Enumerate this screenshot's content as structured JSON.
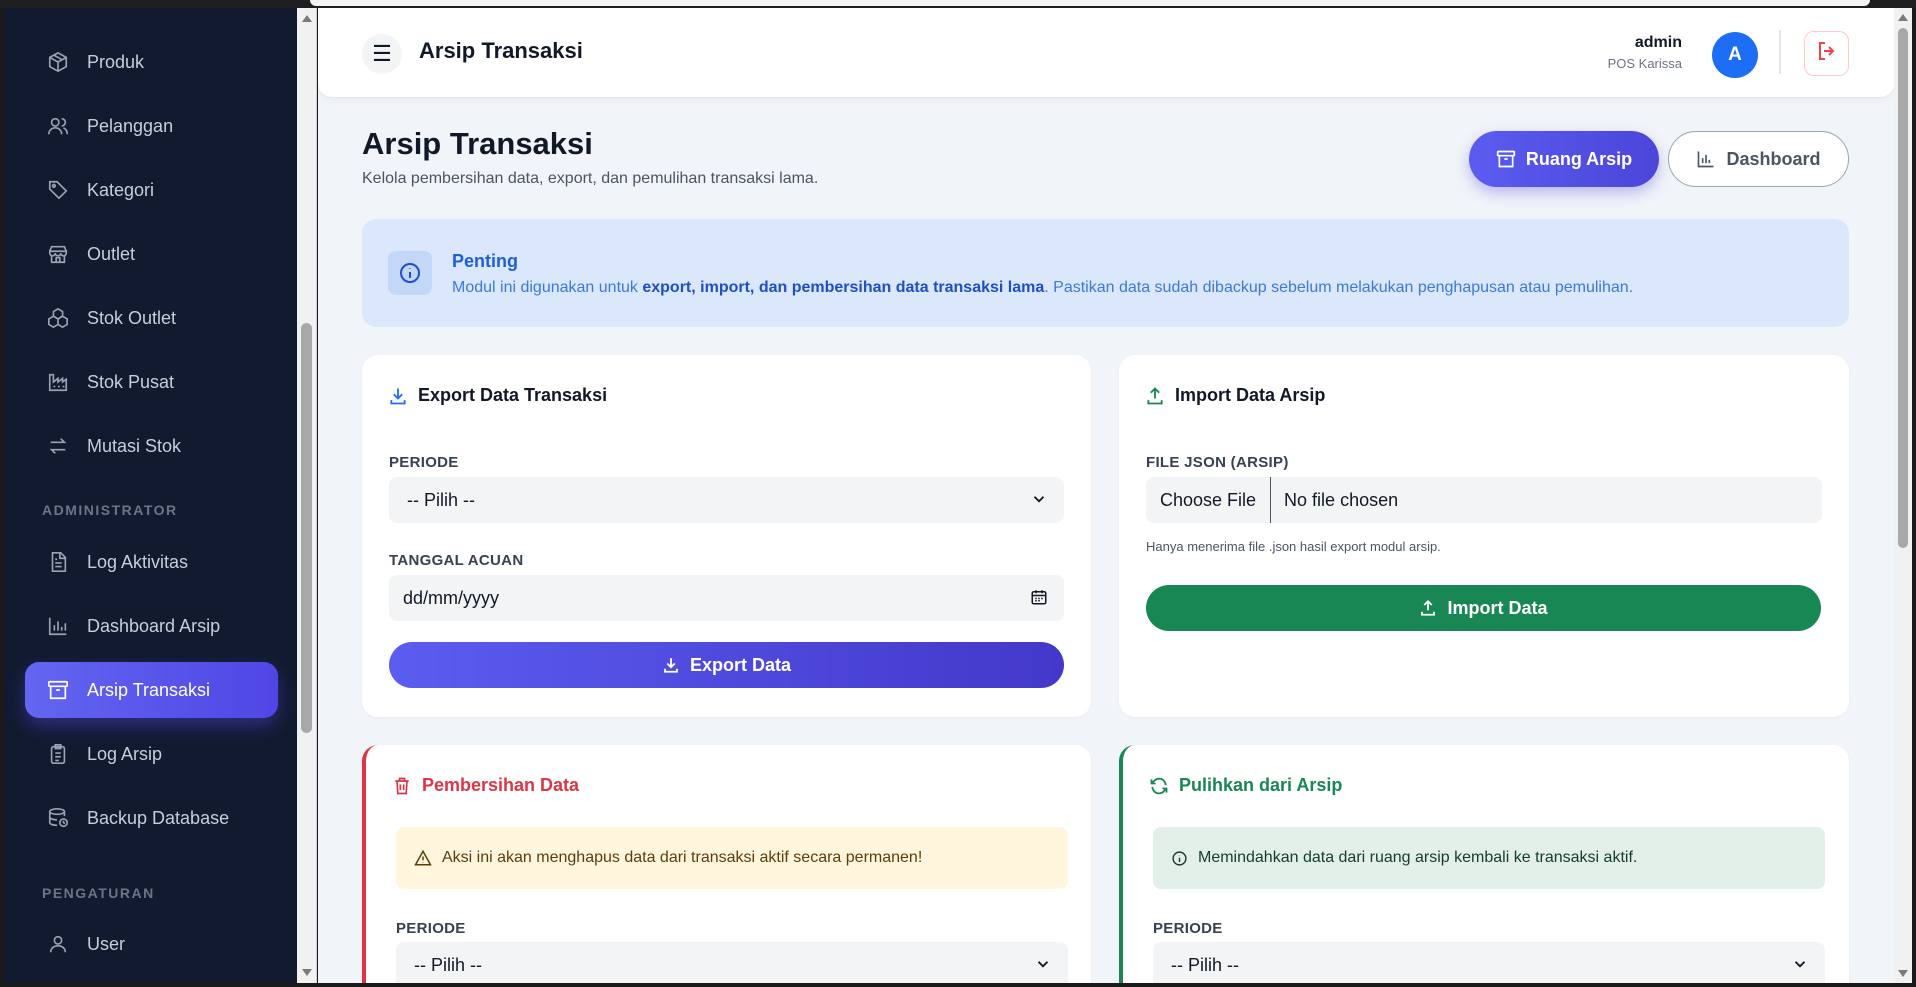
{
  "sidebar": {
    "items": [
      {
        "label": "Produk",
        "icon": "box-icon"
      },
      {
        "label": "Pelanggan",
        "icon": "users-icon"
      },
      {
        "label": "Kategori",
        "icon": "tag-icon"
      },
      {
        "label": "Outlet",
        "icon": "store-icon"
      },
      {
        "label": "Stok Outlet",
        "icon": "boxes-icon"
      },
      {
        "label": "Stok Pusat",
        "icon": "factory-icon"
      },
      {
        "label": "Mutasi Stok",
        "icon": "arrows-swap-icon"
      }
    ],
    "section_admin": "ADMINISTRATOR",
    "admin_items": [
      {
        "label": "Log Aktivitas",
        "icon": "document-icon"
      },
      {
        "label": "Dashboard Arsip",
        "icon": "bar-chart-icon"
      },
      {
        "label": "Arsip Transaksi",
        "icon": "archive-icon",
        "active": true
      },
      {
        "label": "Log Arsip",
        "icon": "clipboard-icon"
      },
      {
        "label": "Backup Database",
        "icon": "database-icon"
      }
    ],
    "section_settings": "PENGATURAN",
    "settings_items": [
      {
        "label": "User",
        "icon": "user-icon"
      }
    ]
  },
  "topbar": {
    "title": "Arsip Transaksi",
    "user_name": "admin",
    "user_role": "POS Karissa",
    "avatar_letter": "A"
  },
  "page": {
    "title": "Arsip Transaksi",
    "subtitle": "Kelola pembersihan data, export, dan pemulihan transaksi lama.",
    "btn_ruang": "Ruang Arsip",
    "btn_dashboard": "Dashboard"
  },
  "info": {
    "title": "Penting",
    "text_before": "Modul ini digunakan untuk ",
    "text_bold": "export, import, dan pembersihan data transaksi lama",
    "text_after": ". Pastikan data sudah dibackup sebelum melakukan penghapusan atau pemulihan."
  },
  "export_card": {
    "title": "Export Data Transaksi",
    "periode_label": "PERIODE",
    "periode_value": "-- Pilih --",
    "tanggal_label": "TANGGAL ACUAN",
    "tanggal_value": "dd/mm/yyyy",
    "button": "Export Data"
  },
  "import_card": {
    "title": "Import Data Arsip",
    "file_label": "FILE JSON (ARSIP)",
    "file_button": "Choose File",
    "file_status": "No file chosen",
    "hint": "Hanya menerima file .json hasil export modul arsip.",
    "button": "Import Data"
  },
  "clean_card": {
    "title": "Pembersihan Data",
    "warning": "Aksi ini akan menghapus data dari transaksi aktif secara permanen!",
    "periode_label": "PERIODE",
    "periode_value": "-- Pilih --"
  },
  "restore_card": {
    "title": "Pulihkan dari Arsip",
    "info": "Memindahkan data dari ruang arsip kembali ke transaksi aktif.",
    "periode_label": "PERIODE",
    "periode_value": "-- Pilih --"
  },
  "colors": {
    "sidebar_bg": "#111a2e",
    "accent": "#5b5cf0",
    "danger": "#dc3545",
    "success": "#198754",
    "info": "#1d5fd6"
  }
}
